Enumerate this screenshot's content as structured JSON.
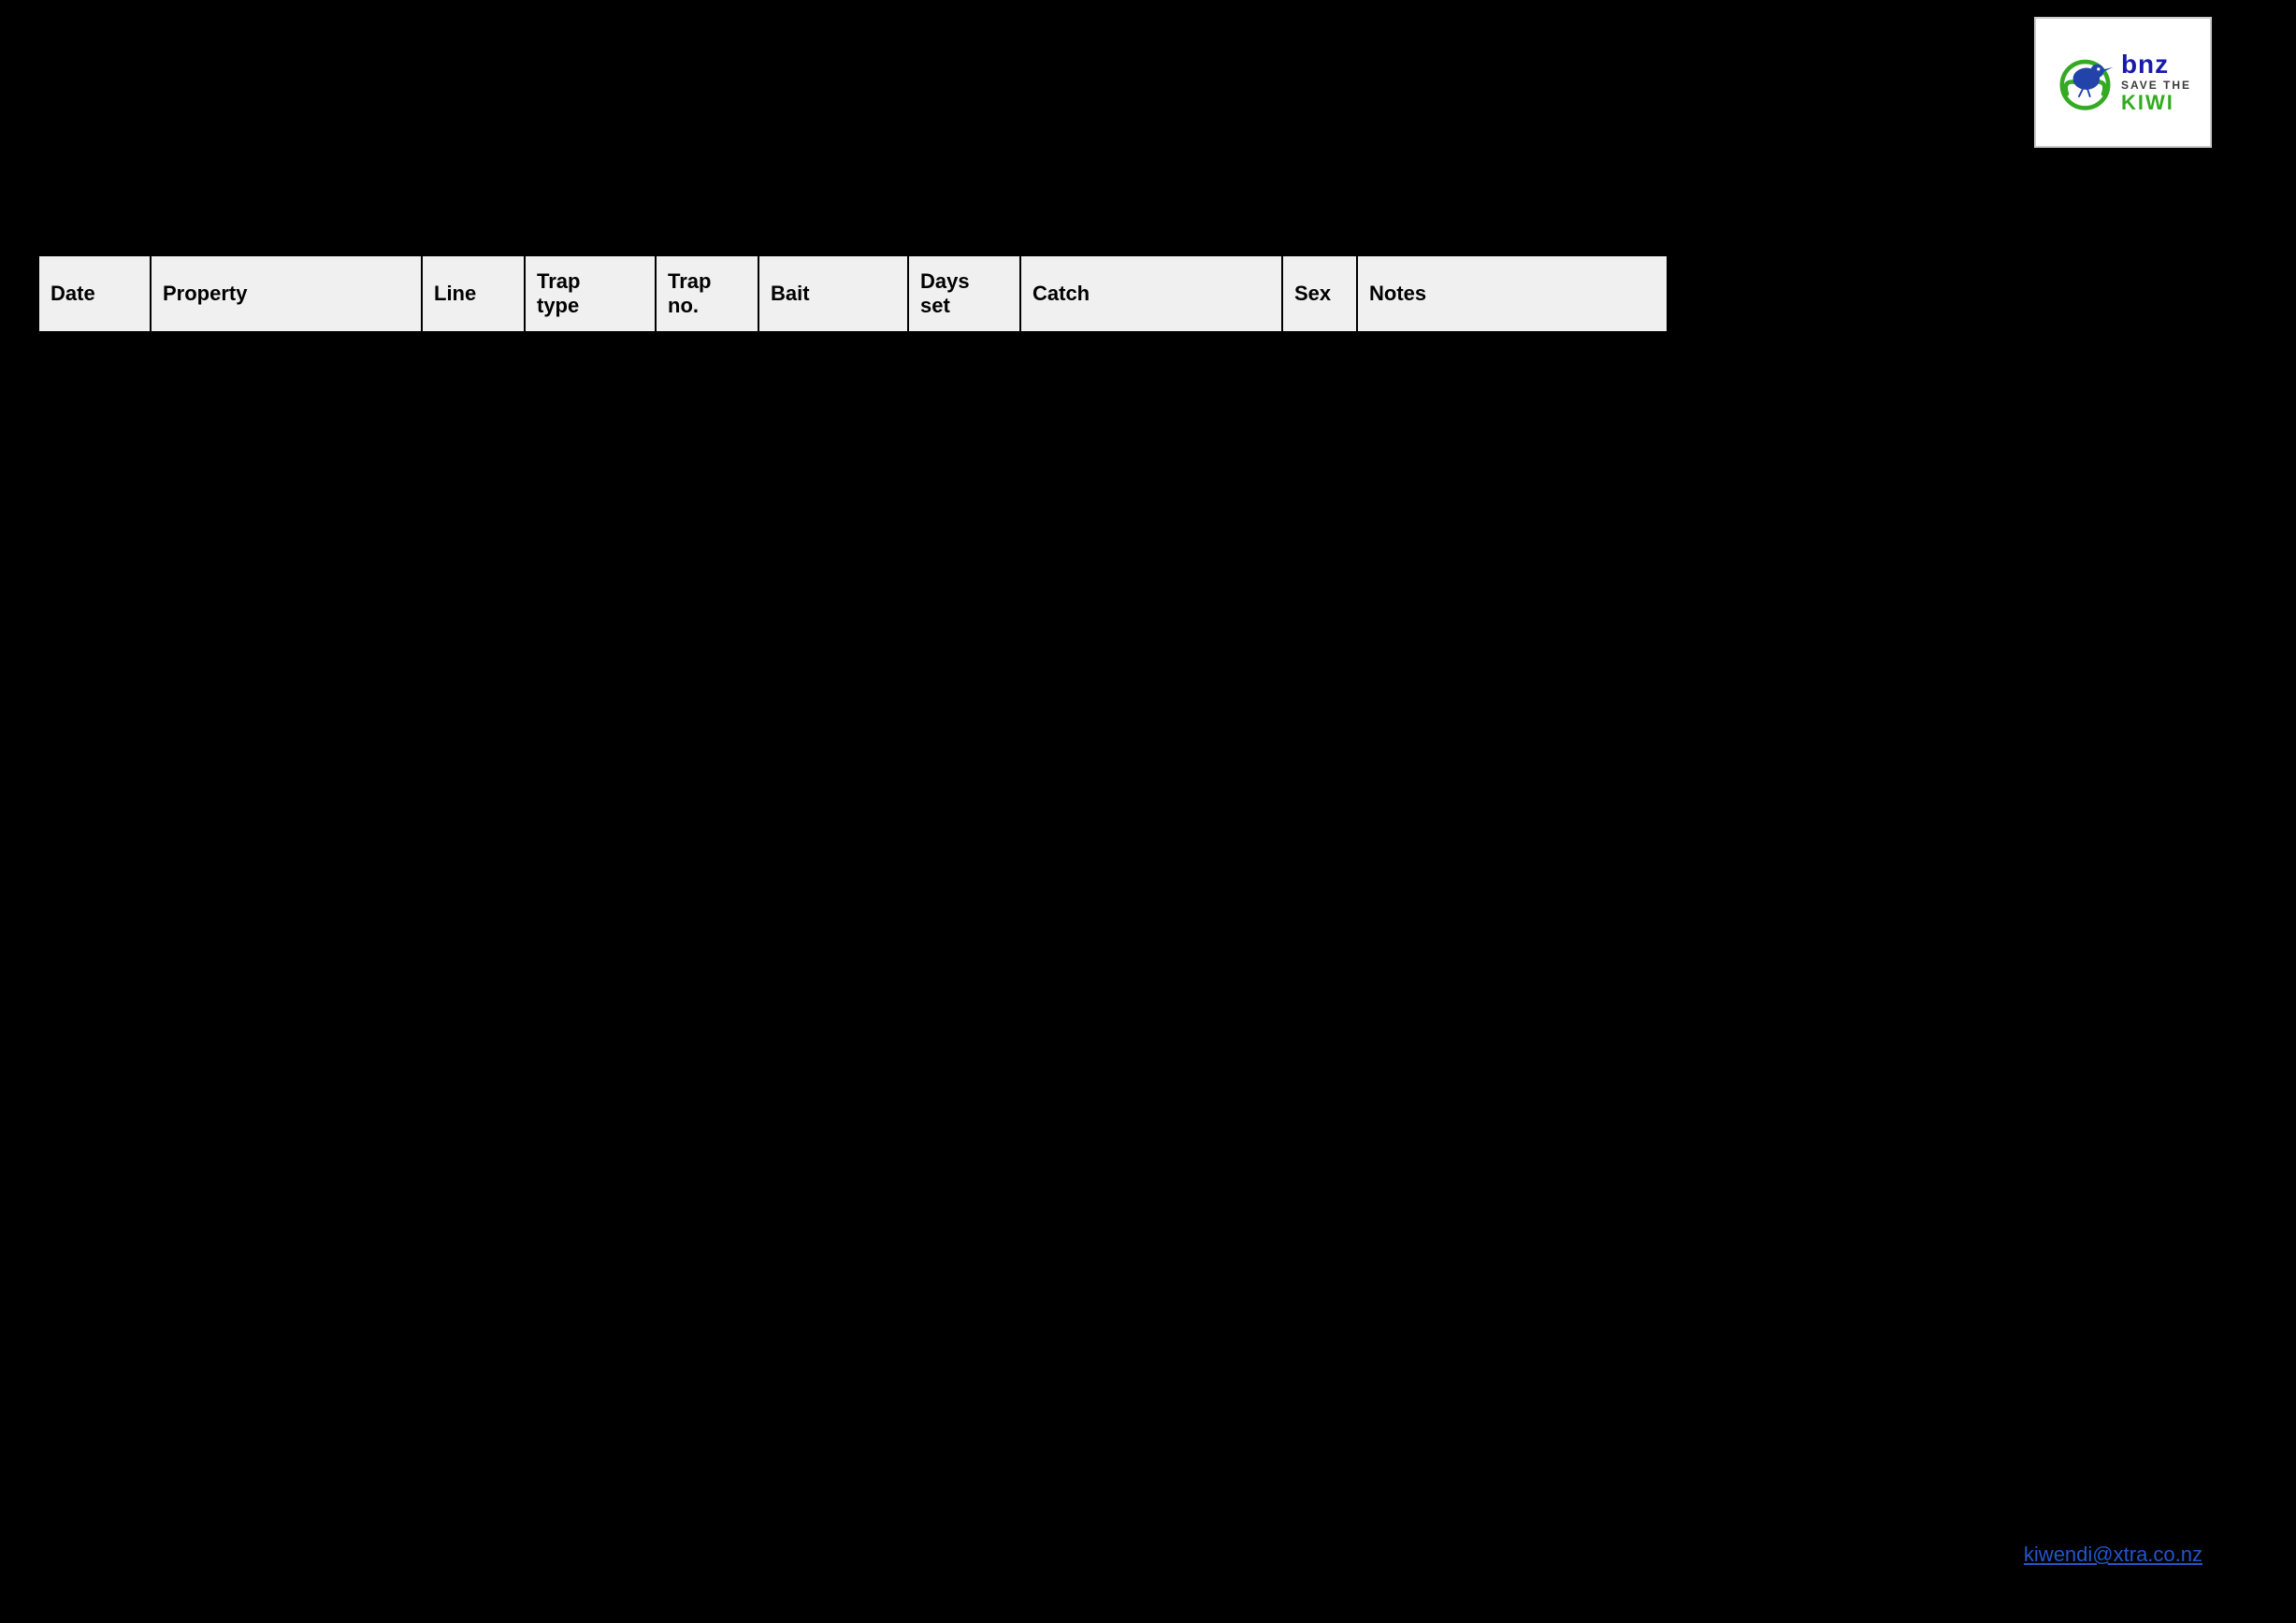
{
  "logo": {
    "bnz_main": "bnz",
    "save_label": "SAVE THE",
    "kiwi_label": "KIWI"
  },
  "table": {
    "headers": [
      {
        "id": "date",
        "label": "Date"
      },
      {
        "id": "property",
        "label": "Property"
      },
      {
        "id": "line",
        "label": "Line"
      },
      {
        "id": "traptype",
        "label": "Trap\ntype"
      },
      {
        "id": "trapno",
        "label": "Trap\nno."
      },
      {
        "id": "bait",
        "label": "Bait"
      },
      {
        "id": "daysset",
        "label": "Days\nset"
      },
      {
        "id": "catch",
        "label": "Catch"
      },
      {
        "id": "sex",
        "label": "Sex"
      },
      {
        "id": "notes",
        "label": "Notes"
      }
    ]
  },
  "footer": {
    "email": "kiwendi@xtra.co.nz"
  }
}
